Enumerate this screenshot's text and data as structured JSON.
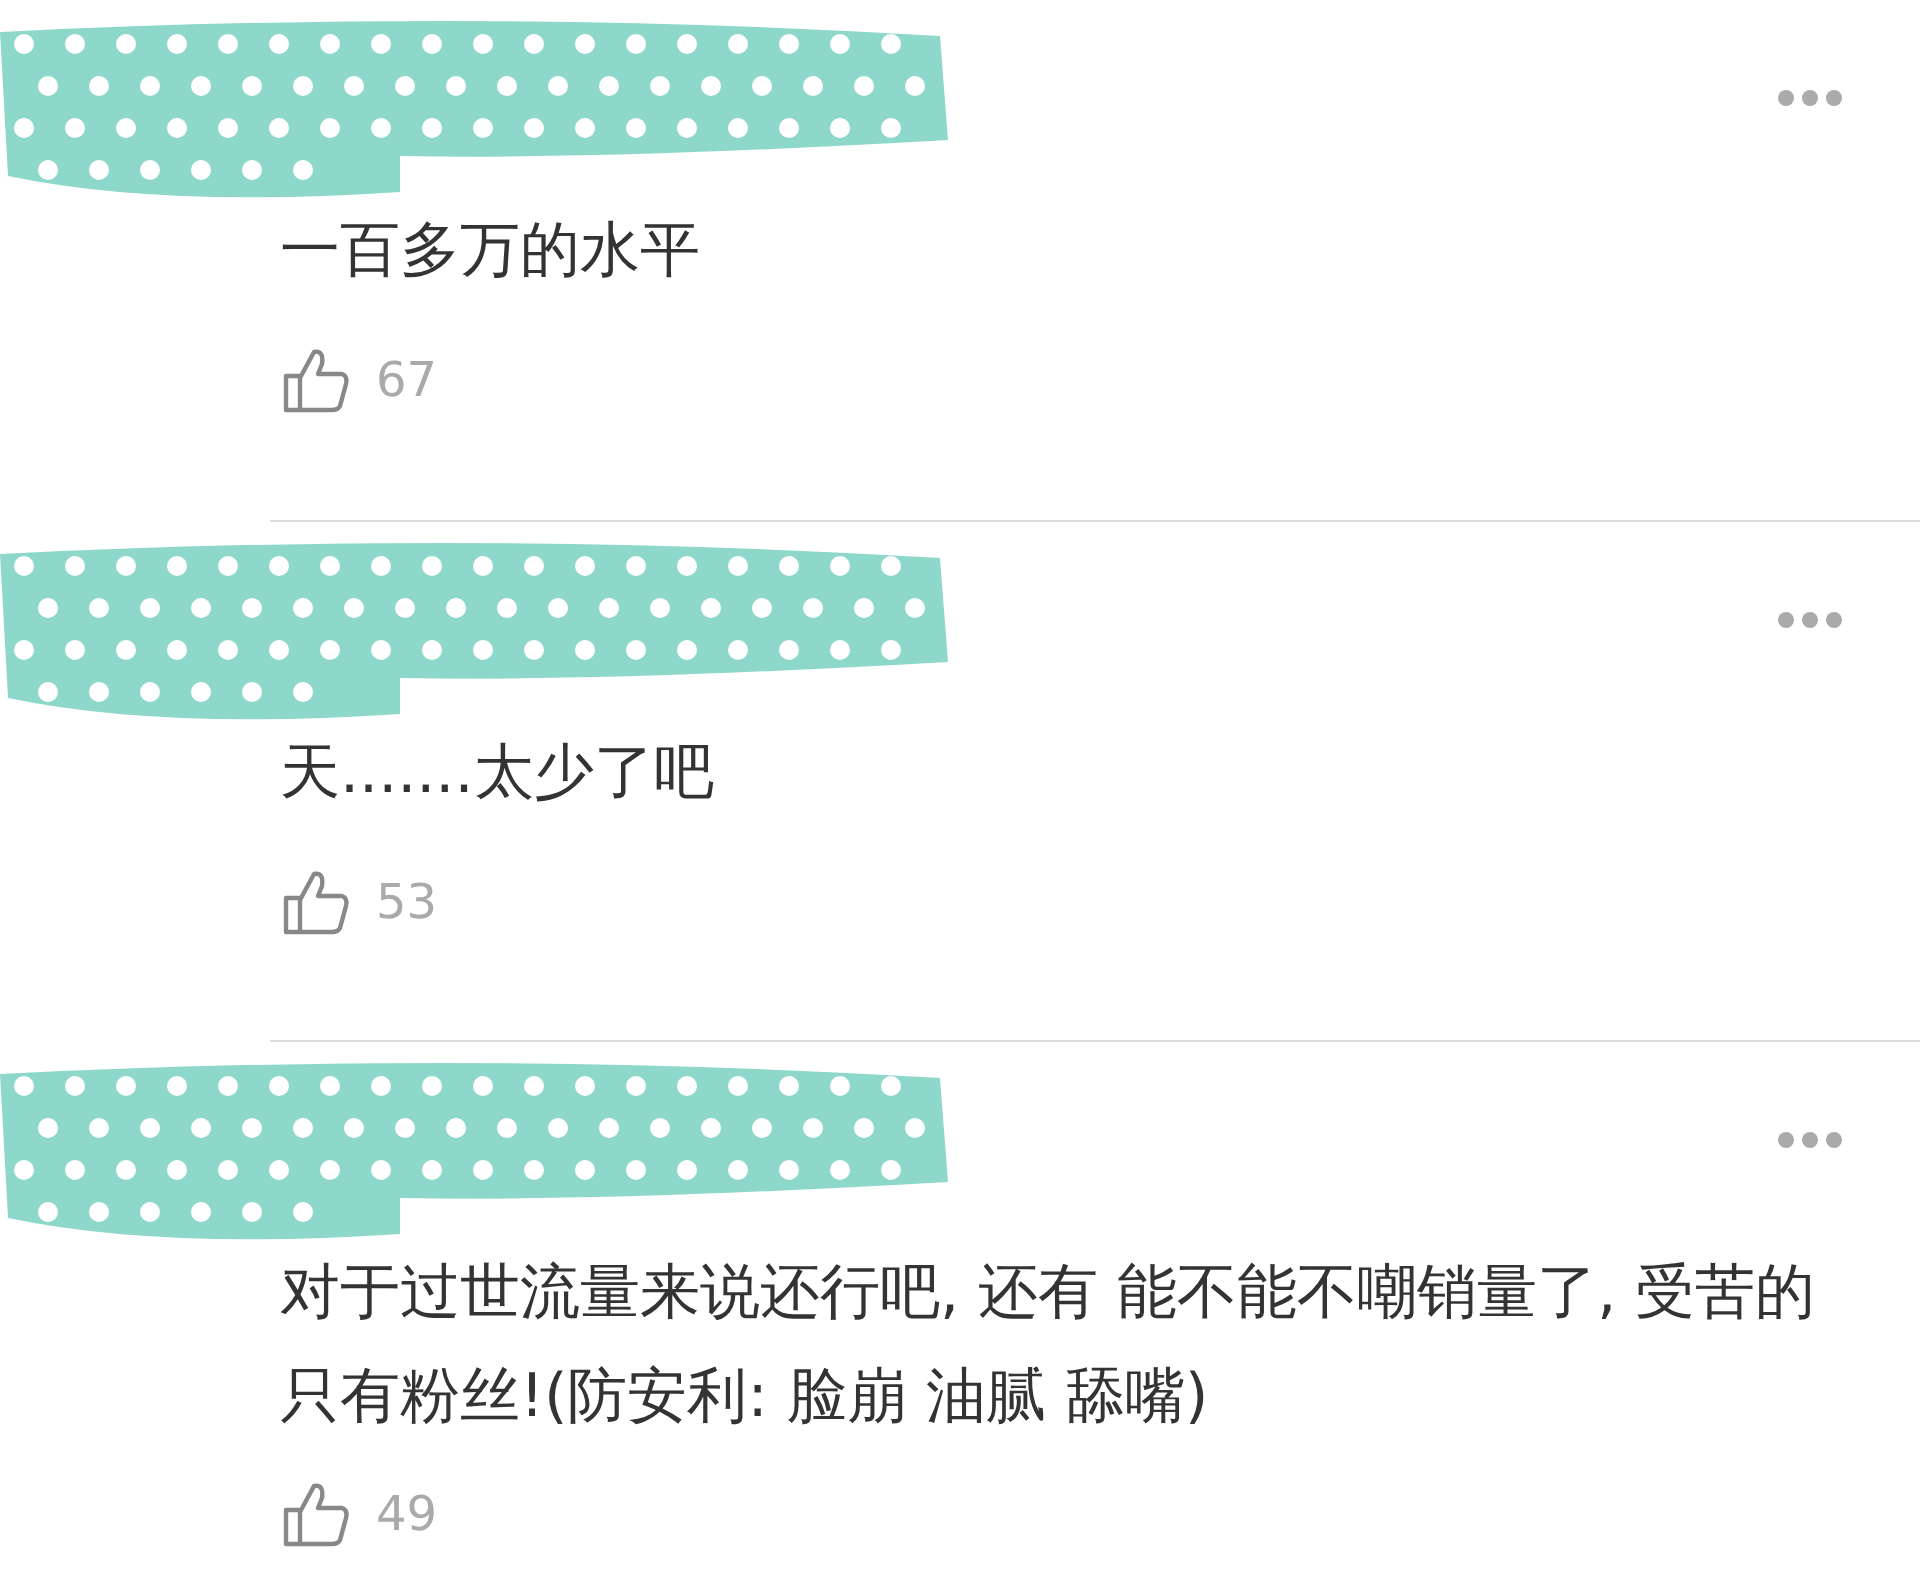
{
  "comments": [
    {
      "text": "一百多万的水平",
      "likes": "67"
    },
    {
      "text": "天.......太少了吧",
      "likes": "53"
    },
    {
      "text": "对于过世流量来说还行吧, 还有 能不能不嘲销量了, 受苦的只有粉丝!(防安利: 脸崩 油腻 舔嘴)",
      "likes": "49"
    }
  ]
}
